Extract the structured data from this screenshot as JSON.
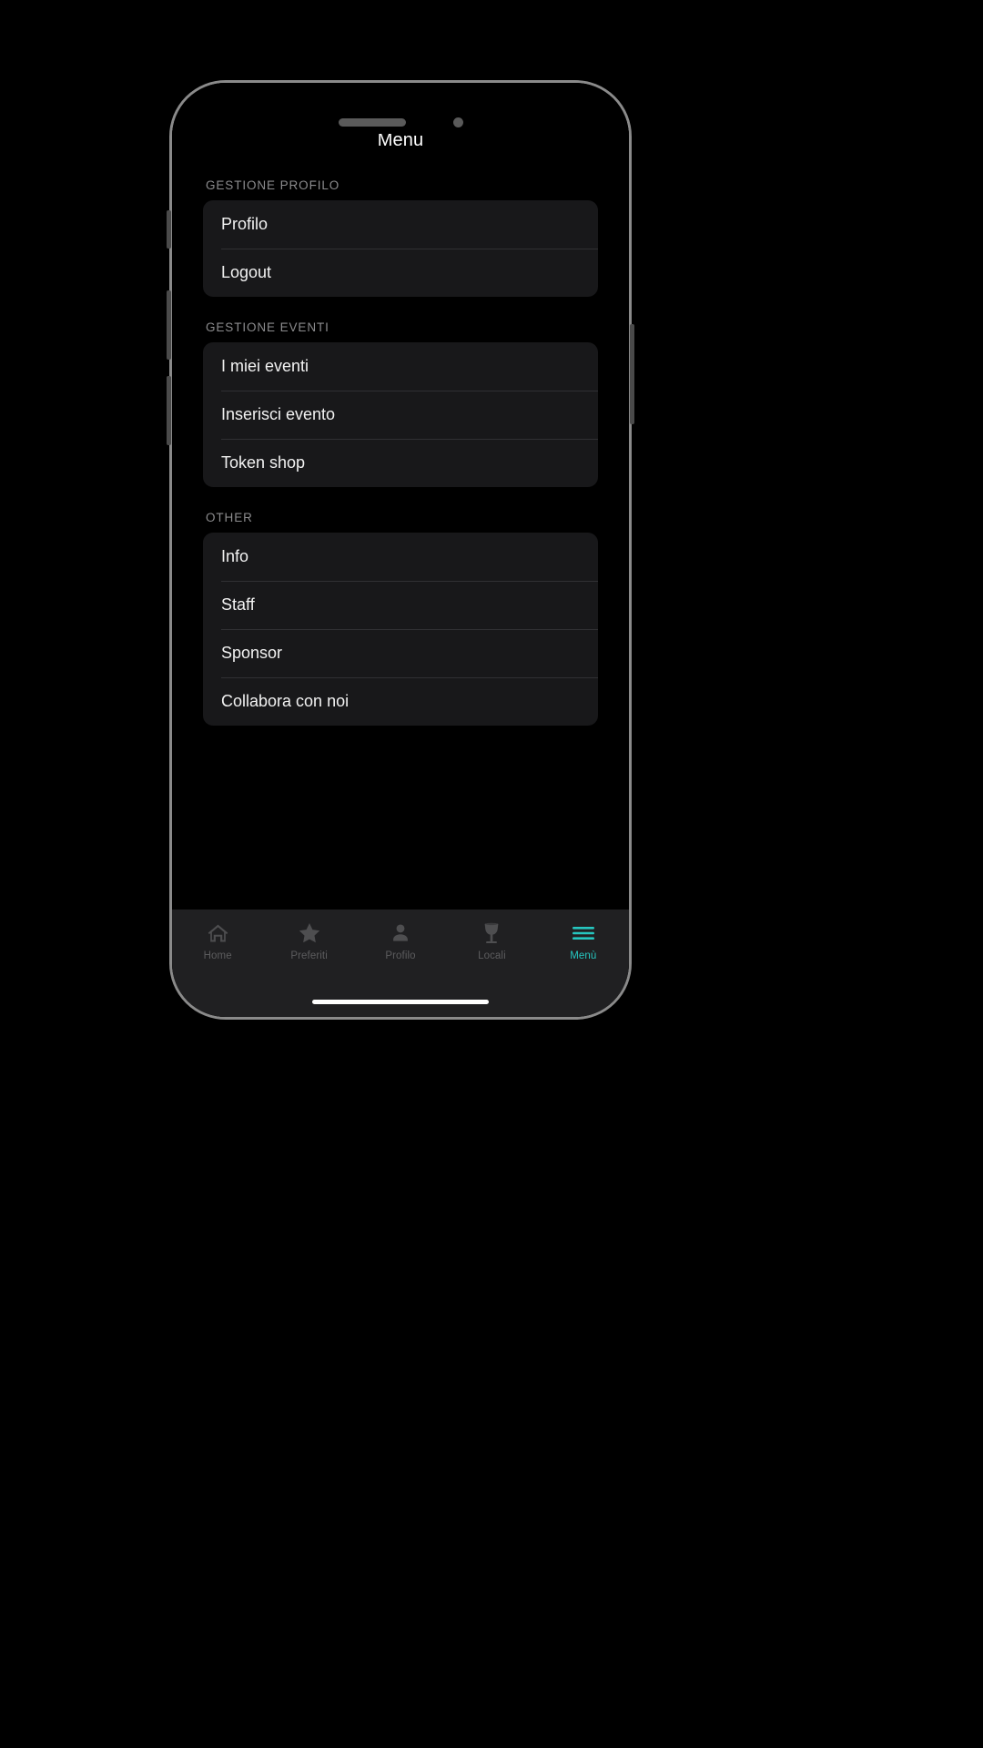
{
  "app": {
    "nav_title": "Menu",
    "accent_color": "#26c6c0",
    "screen_background": "#000000",
    "card_background": "#18181a",
    "text_color": "#f2f2f2",
    "section_header_color": "#8c8c8e"
  },
  "sections": [
    {
      "header": "GESTIONE PROFILO",
      "items": [
        {
          "label": "Profilo"
        },
        {
          "label": "Logout"
        }
      ]
    },
    {
      "header": "GESTIONE EVENTI",
      "items": [
        {
          "label": "I miei eventi"
        },
        {
          "label": "Inserisci evento"
        },
        {
          "label": "Token shop"
        }
      ]
    },
    {
      "header": "OTHER",
      "items": [
        {
          "label": "Info"
        },
        {
          "label": "Staff"
        },
        {
          "label": "Sponsor"
        },
        {
          "label": "Collabora con noi"
        }
      ]
    }
  ],
  "tab_bar": {
    "items": [
      {
        "label": "Home",
        "icon": "home-icon",
        "active": false
      },
      {
        "label": "Preferiti",
        "icon": "star-icon",
        "active": false
      },
      {
        "label": "Profilo",
        "icon": "person-icon",
        "active": false
      },
      {
        "label": "Locali",
        "icon": "wine-glass-icon",
        "active": false
      },
      {
        "label": "Menù",
        "icon": "hamburger-icon",
        "active": true
      }
    ]
  }
}
